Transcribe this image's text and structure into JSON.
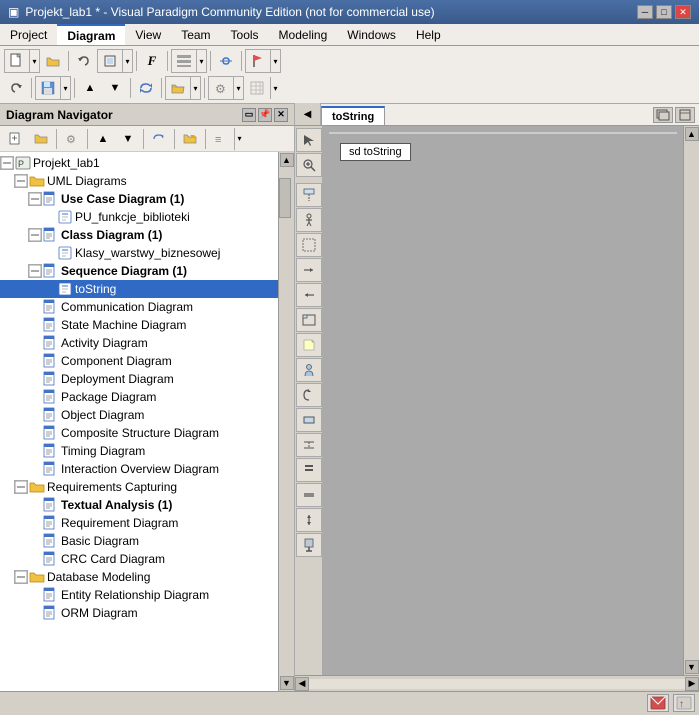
{
  "titlebar": {
    "title": "Projekt_lab1 * - Visual Paradigm Community Edition (not for commercial use)",
    "icon": "▣",
    "min_btn": "─",
    "max_btn": "□",
    "close_btn": "✕"
  },
  "menubar": {
    "items": [
      {
        "label": "Project",
        "active": false
      },
      {
        "label": "Diagram",
        "active": true
      },
      {
        "label": "View",
        "active": false
      },
      {
        "label": "Team",
        "active": false
      },
      {
        "label": "Tools",
        "active": false
      },
      {
        "label": "Modeling",
        "active": false
      },
      {
        "label": "Windows",
        "active": false
      },
      {
        "label": "Help",
        "active": false
      }
    ]
  },
  "diagram_navigator": {
    "title": "Diagram Navigator",
    "tree": [
      {
        "id": "root",
        "label": "Projekt_lab1",
        "level": 0,
        "expanded": true,
        "type": "project",
        "icon": "proj"
      },
      {
        "id": "uml",
        "label": "UML Diagrams",
        "level": 1,
        "expanded": true,
        "type": "folder",
        "icon": "folder"
      },
      {
        "id": "uc",
        "label": "Use Case Diagram (1)",
        "level": 2,
        "expanded": true,
        "type": "diagram",
        "icon": "diagram",
        "bold": true
      },
      {
        "id": "pu",
        "label": "PU_funkcje_biblioteki",
        "level": 3,
        "expanded": false,
        "type": "item",
        "icon": "item"
      },
      {
        "id": "cd",
        "label": "Class Diagram (1)",
        "level": 2,
        "expanded": true,
        "type": "diagram",
        "icon": "diagram",
        "bold": true
      },
      {
        "id": "kl",
        "label": "Klasy_warstwy_biznesowej",
        "level": 3,
        "expanded": false,
        "type": "item",
        "icon": "item"
      },
      {
        "id": "sd",
        "label": "Sequence Diagram (1)",
        "level": 2,
        "expanded": true,
        "type": "diagram",
        "icon": "diagram",
        "bold": true
      },
      {
        "id": "ts",
        "label": "toString",
        "level": 3,
        "expanded": false,
        "type": "item",
        "icon": "item",
        "selected": true
      },
      {
        "id": "comm",
        "label": "Communication Diagram",
        "level": 2,
        "expanded": false,
        "type": "diagram",
        "icon": "diagram"
      },
      {
        "id": "smd",
        "label": "State Machine Diagram",
        "level": 2,
        "expanded": false,
        "type": "diagram",
        "icon": "diagram"
      },
      {
        "id": "act",
        "label": "Activity Diagram",
        "level": 2,
        "expanded": false,
        "type": "diagram",
        "icon": "diagram"
      },
      {
        "id": "comp",
        "label": "Component Diagram",
        "level": 2,
        "expanded": false,
        "type": "diagram",
        "icon": "diagram"
      },
      {
        "id": "dep",
        "label": "Deployment Diagram",
        "level": 2,
        "expanded": false,
        "type": "diagram",
        "icon": "diagram"
      },
      {
        "id": "pkg",
        "label": "Package Diagram",
        "level": 2,
        "expanded": false,
        "type": "diagram",
        "icon": "diagram"
      },
      {
        "id": "obj",
        "label": "Object Diagram",
        "level": 2,
        "expanded": false,
        "type": "diagram",
        "icon": "diagram"
      },
      {
        "id": "csd",
        "label": "Composite Structure Diagram",
        "level": 2,
        "expanded": false,
        "type": "diagram",
        "icon": "diagram"
      },
      {
        "id": "tim",
        "label": "Timing Diagram",
        "level": 2,
        "expanded": false,
        "type": "diagram",
        "icon": "diagram"
      },
      {
        "id": "iod",
        "label": "Interaction Overview Diagram",
        "level": 2,
        "expanded": false,
        "type": "diagram",
        "icon": "diagram"
      },
      {
        "id": "rc",
        "label": "Requirements Capturing",
        "level": 1,
        "expanded": true,
        "type": "folder",
        "icon": "folder"
      },
      {
        "id": "ta",
        "label": "Textual Analysis (1)",
        "level": 2,
        "expanded": true,
        "type": "diagram",
        "icon": "diagram",
        "bold": true
      },
      {
        "id": "rd",
        "label": "Requirement Diagram",
        "level": 2,
        "expanded": false,
        "type": "diagram",
        "icon": "diagram"
      },
      {
        "id": "bd",
        "label": "Basic Diagram",
        "level": 2,
        "expanded": false,
        "type": "diagram",
        "icon": "diagram"
      },
      {
        "id": "crc",
        "label": "CRC Card Diagram",
        "level": 2,
        "expanded": false,
        "type": "diagram",
        "icon": "diagram"
      },
      {
        "id": "dbm",
        "label": "Database Modeling",
        "level": 1,
        "expanded": true,
        "type": "folder",
        "icon": "folder"
      },
      {
        "id": "erd",
        "label": "Entity Relationship Diagram",
        "level": 2,
        "expanded": false,
        "type": "diagram",
        "icon": "diagram"
      },
      {
        "id": "orm",
        "label": "ORM Diagram",
        "level": 2,
        "expanded": false,
        "type": "diagram",
        "icon": "diagram"
      }
    ]
  },
  "diagram_area": {
    "tab_label": "toString",
    "tab_arrow": "▸",
    "sd_label": "sd toString",
    "canvas_bg": "#ffffff"
  },
  "right_toolbar": {
    "buttons": [
      "▶",
      "↗",
      "↙",
      "⟶",
      "⟵",
      "⊡",
      "⊞",
      "◎",
      "⊕",
      "⊗",
      "◈",
      "⊟",
      "⊠",
      "▦",
      "⊙",
      "⊛",
      "⊜",
      "↕",
      "⊝"
    ]
  },
  "status_bar": {
    "email_icon": "✉",
    "settings_icon": "⚙"
  }
}
